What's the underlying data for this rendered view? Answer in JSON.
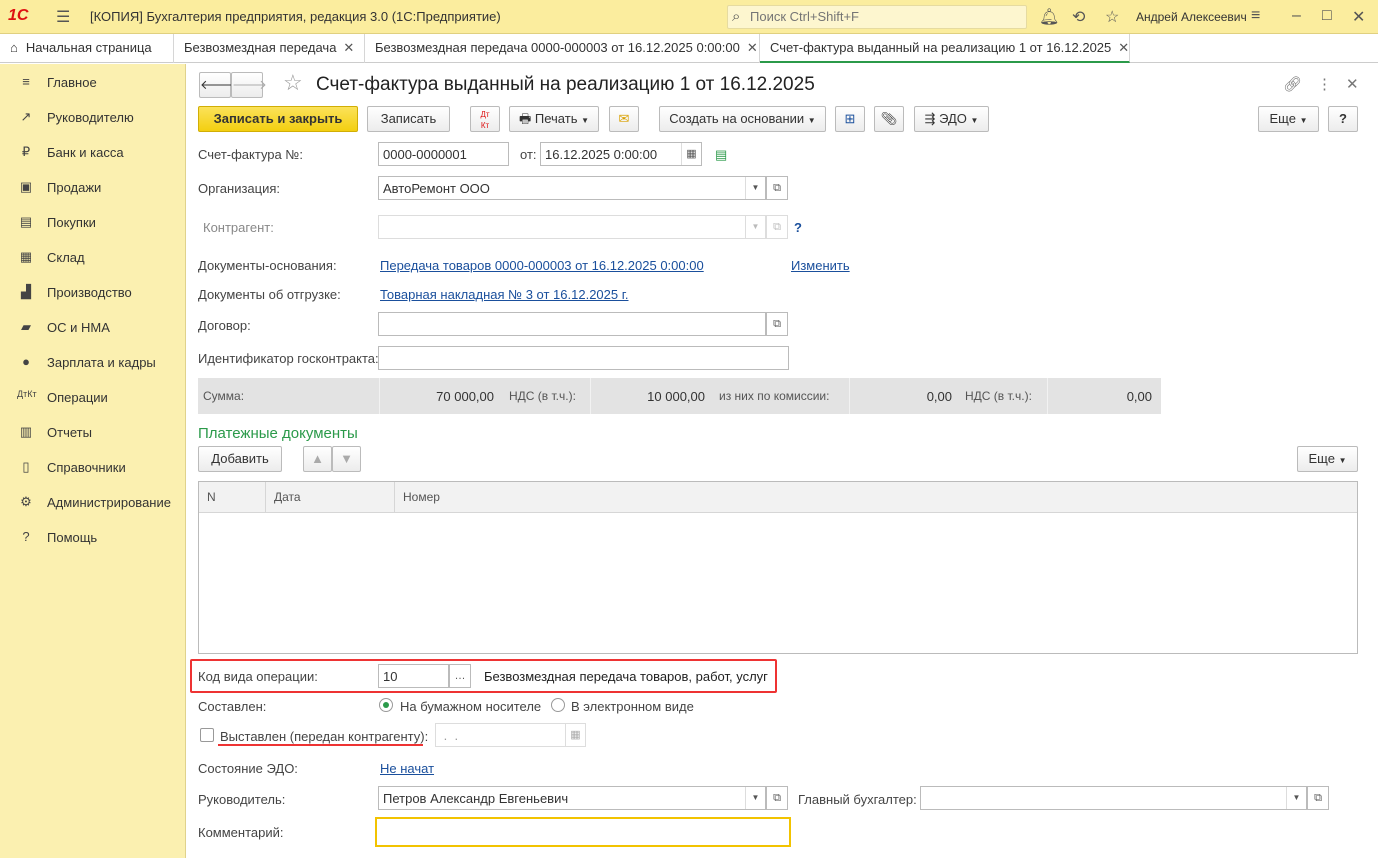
{
  "titlebar": {
    "logo": "1С",
    "title": "[КОПИЯ] Бухгалтерия предприятия, редакция 3.0  (1С:Предприятие)",
    "search_placeholder": "Поиск Ctrl+Shift+F",
    "user": "Андрей Алексеевич"
  },
  "tabs": [
    {
      "label": "Начальная страница"
    },
    {
      "label": "Безвозмездная передача"
    },
    {
      "label": "Безвозмездная передача 0000-000003 от 16.12.2025 0:00:00"
    },
    {
      "label": "Счет-фактура выданный на реализацию 1 от 16.12.2025"
    }
  ],
  "sidebar": {
    "items": [
      {
        "label": "Главное",
        "icon": "menu-icon"
      },
      {
        "label": "Руководителю",
        "icon": "trend-icon"
      },
      {
        "label": "Банк и касса",
        "icon": "ruble-icon"
      },
      {
        "label": "Продажи",
        "icon": "cart-icon"
      },
      {
        "label": "Покупки",
        "icon": "basket-icon"
      },
      {
        "label": "Склад",
        "icon": "grid-icon"
      },
      {
        "label": "Производство",
        "icon": "factory-icon"
      },
      {
        "label": "ОС и НМА",
        "icon": "truck-icon"
      },
      {
        "label": "Зарплата и кадры",
        "icon": "person-icon"
      },
      {
        "label": "Операции",
        "icon": "dt-kt-icon"
      },
      {
        "label": "Отчеты",
        "icon": "chart-icon"
      },
      {
        "label": "Справочники",
        "icon": "book-icon"
      },
      {
        "label": "Администрирование",
        "icon": "gear-icon"
      },
      {
        "label": "Помощь",
        "icon": "help-icon"
      }
    ]
  },
  "doc": {
    "title": "Счет-фактура выданный на реализацию 1 от 16.12.2025",
    "toolbar": {
      "save_close": "Записать и закрыть",
      "save": "Записать",
      "print": "Печать",
      "create_based": "Создать на основании",
      "edo": "ЭДО",
      "more": "Еще",
      "help": "?"
    },
    "invoice_no_label": "Счет-фактура №:",
    "invoice_no": "0000-0000001",
    "date_label": "от:",
    "date": "16.12.2025  0:00:00",
    "org_label": "Организация:",
    "org": "АвтоРемонт ООО",
    "counterparty_label": "Контрагент:",
    "counterparty": "",
    "base_docs_label": "Документы-основания:",
    "base_docs": "Передача товаров 0000-000003 от 16.12.2025 0:00:00",
    "change": "Изменить",
    "ship_docs_label": "Документы об отгрузке:",
    "ship_docs": "Товарная накладная № 3 от 16.12.2025 г.",
    "contract_label": "Договор:",
    "contract": "",
    "gov_contract_label": "Идентификатор госконтракта:",
    "gov_contract": "",
    "sum": {
      "sum_label": "Сумма:",
      "sum": "70 000,00",
      "vat_label": "НДС (в т.ч.):",
      "vat": "10 000,00",
      "commission_label": "из них по комиссии:",
      "commission": "0,00",
      "vat2_label": "НДС (в т.ч.):",
      "vat2": "0,00"
    },
    "payments": {
      "title": "Платежные документы",
      "add": "Добавить",
      "more": "Еще",
      "columns": [
        "N",
        "Дата",
        "Номер"
      ]
    },
    "op_code_label": "Код вида операции:",
    "op_code": "10",
    "op_code_desc": "Безвозмездная передача товаров, работ, услуг",
    "composed_label": "Составлен:",
    "paper": "На бумажном носителе",
    "electronic": "В электронном виде",
    "issued_label": "Выставлен (передан контрагенту):",
    "issued_date": " .  .",
    "edo_state_label": "Состояние ЭДО:",
    "edo_state": "Не начат",
    "head_label": "Руководитель:",
    "head": "Петров Александр Евгеньевич",
    "chief_acc_label": "Главный бухгалтер:",
    "chief_acc": "",
    "comment_label": "Комментарий:",
    "comment": ""
  }
}
